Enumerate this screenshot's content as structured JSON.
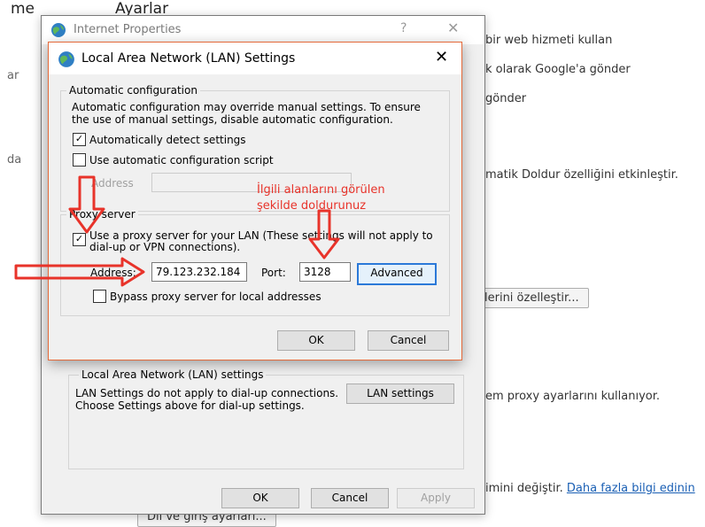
{
  "background_page": {
    "header_left": "me",
    "header_title": "Ayarlar",
    "side_text_1": "ar",
    "side_text_2": "da",
    "line_1": "bir web hizmeti kullan",
    "line_2": "k olarak Google'a gönder",
    "line_3": "gönder",
    "line_4": "matik Doldur özelliğini etkinleştir.",
    "line_5_button": "lerini özelleştir...",
    "line_6": "em proxy ayarlarını kullanıyor.",
    "line_7": "imini değiştir.",
    "line_7_link": "Daha fazla bilgi edinin",
    "bottom_button": "Dil ve giriş ayarları..."
  },
  "internet_properties": {
    "title": "Internet Properties",
    "help_glyph": "?",
    "close_glyph": "✕",
    "lan_section_title": "Local Area Network (LAN) settings",
    "lan_section_desc": "LAN Settings do not apply to dial-up connections. Choose Settings above for dial-up settings.",
    "lan_settings_button": "LAN settings",
    "ok_button": "OK",
    "cancel_button": "Cancel",
    "apply_button": "Apply"
  },
  "lan_dialog": {
    "title": "Local Area Network (LAN) Settings",
    "close_glyph": "✕",
    "auto_config": {
      "group_title": "Automatic configuration",
      "description": "Automatic configuration may override manual settings.  To ensure the use of manual settings, disable automatic configuration.",
      "auto_detect_label": "Automatically detect settings",
      "auto_detect_checked": true,
      "script_label": "Use automatic configuration script",
      "script_checked": false,
      "address_label": "Address",
      "address_value": ""
    },
    "proxy": {
      "group_title": "Proxy server",
      "use_proxy_label": "Use a proxy server for your LAN (These settings will not apply to dial-up or VPN connections).",
      "use_proxy_checked": true,
      "address_label": "Address:",
      "address_value": "79.123.232.184",
      "port_label": "Port:",
      "port_value": "3128",
      "advanced_button": "Advanced",
      "bypass_label": "Bypass proxy server for local addresses",
      "bypass_checked": false
    },
    "ok_button": "OK",
    "cancel_button": "Cancel"
  },
  "annotation": {
    "line_1": "İlgili alanlarını görülen",
    "line_2": "şekilde doldurunuz",
    "color": "#e8332a"
  },
  "check_glyph": "✓"
}
